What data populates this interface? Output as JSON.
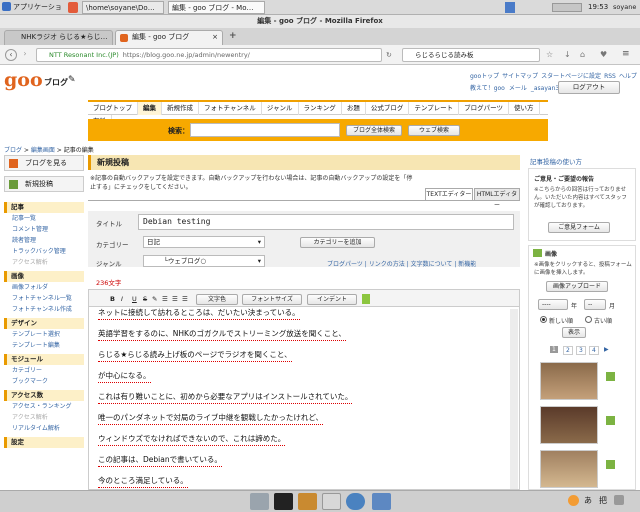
{
  "topbar": {
    "apps": "アプリケーション",
    "task1": "\\home\\soyane\\Do…",
    "task2": "編集 - goo ブログ - Mo…",
    "clock": "19:53",
    "user": "soyane"
  },
  "window": {
    "title": "編集 - goo ブログ - Mozilla Firefox"
  },
  "tabs": [
    {
      "label": "NHKラジオ らじる★らじ…"
    },
    {
      "label": "編集 - goo ブログ"
    }
  ],
  "nav": {
    "site": "NTT Resonant Inc.(JP)",
    "url": "https://blog.goo.ne.jp/admin/newentry/",
    "search": "らじるらじる読み板"
  },
  "header": {
    "logo": "goo",
    "logo_sub": "ブログ",
    "links": [
      "gooトップ",
      "サイトマップ",
      "スタートページに設定",
      "RSS",
      "ヘルプ"
    ],
    "greeting": "教えて！goo",
    "mail": "メール",
    "user": "_asayan33",
    "logout": "ログアウト"
  },
  "menu": [
    "ブログトップ",
    "編集",
    "新規作成",
    "フォトチャンネル",
    "ジャンル",
    "ランキング",
    "お題",
    "公式ブログ",
    "テンプレート",
    "ブログパーツ",
    "使い方",
    "有料"
  ],
  "search": {
    "label": "検索：",
    "btn1": "ブログ全体検索",
    "btn2": "ウェブ検索"
  },
  "breadcrumb": [
    "ブログ",
    "編集画面",
    "記事の編集"
  ],
  "sidebar": {
    "view": "ブログを見る",
    "post": "新規投稿",
    "sections": [
      {
        "title": "記事",
        "items": [
          "記事一覧",
          "コメント管理",
          "読者管理",
          "トラックバック管理",
          "アクセス解析"
        ]
      },
      {
        "title": "画像",
        "items": [
          "画像フォルダ",
          "フォトチャンネル一覧",
          "フォトチャンネル作成"
        ]
      },
      {
        "title": "デザイン",
        "items": [
          "テンプレート選択",
          "テンプレート編集"
        ]
      },
      {
        "title": "モジュール",
        "items": [
          "カテゴリー",
          "ブックマーク"
        ]
      },
      {
        "title": "アクセス数",
        "items": [
          "アクセス・ランキング",
          "アクセス解析",
          "リアルタイム解析"
        ]
      },
      {
        "title": "設定",
        "items": []
      }
    ]
  },
  "editor": {
    "heading": "新規投稿",
    "notice": "※記事の自動バックアップを設定できます。自動バックアップを行わない場合は、記事の自動バックアップの設定を「停止する」にチェックをしてください。",
    "tab_text": "TEXTエディター",
    "tab_html": "HTMLエディター",
    "title_label": "タイトル",
    "title_value": "Debian testing",
    "category_label": "カテゴリー",
    "category_value": "日記",
    "add_category": "カテゴリーを追加",
    "genre_label": "ジャンル",
    "genre_value": "└ウェブログ○",
    "links": [
      "ブログパーツ",
      "リンクの方法",
      "文字数について",
      "新機能"
    ],
    "count": "236文字",
    "tb": [
      "B",
      "I",
      "U",
      "S"
    ],
    "tb_text": [
      "文字色",
      "フォントサイズ",
      "インデント"
    ],
    "lines": [
      "ネットに接続して訪れるところは、だいたい決まっている。",
      "英語学習をするのに、NHKのゴガクルでストリーミング放送を聞くこと、",
      "らじる★らじる読み上げ板のページでラジオを聞くこと、",
      "が中心になる。",
      "これは有り難いことに、初めから必要なアプリはインストールされていた。",
      "唯一のパンダネットで対局のライブ中継を観戦したかったけれど、",
      "ウィンドウズでなければできないので、これは諦めた。",
      "この記事は、Debianで書いている。",
      "今のところ満足している。"
    ]
  },
  "right": {
    "guide": "記事投稿の使い方",
    "notice_title": "ご意見・ご要望の報告",
    "notice_body": "※こちらからの回答は行っておりません。いただいた内容はすべてスタッフが確認しております。",
    "form_btn": "ご意見フォーム",
    "image_title": "画像",
    "image_hint": "※画像をクリックすると、投稿フォームに画像を挿入します。",
    "upload": "画像アップロード",
    "year": "----",
    "year_unit": "年",
    "month": "--",
    "month_unit": "月",
    "sort_new": "新しい順",
    "sort_old": "古い順",
    "show": "表示",
    "pages": [
      "1",
      "2",
      "3",
      "4"
    ]
  },
  "colors": {
    "accent": "#f7a900",
    "link": "#3465a4",
    "goo": "#e0641e"
  }
}
